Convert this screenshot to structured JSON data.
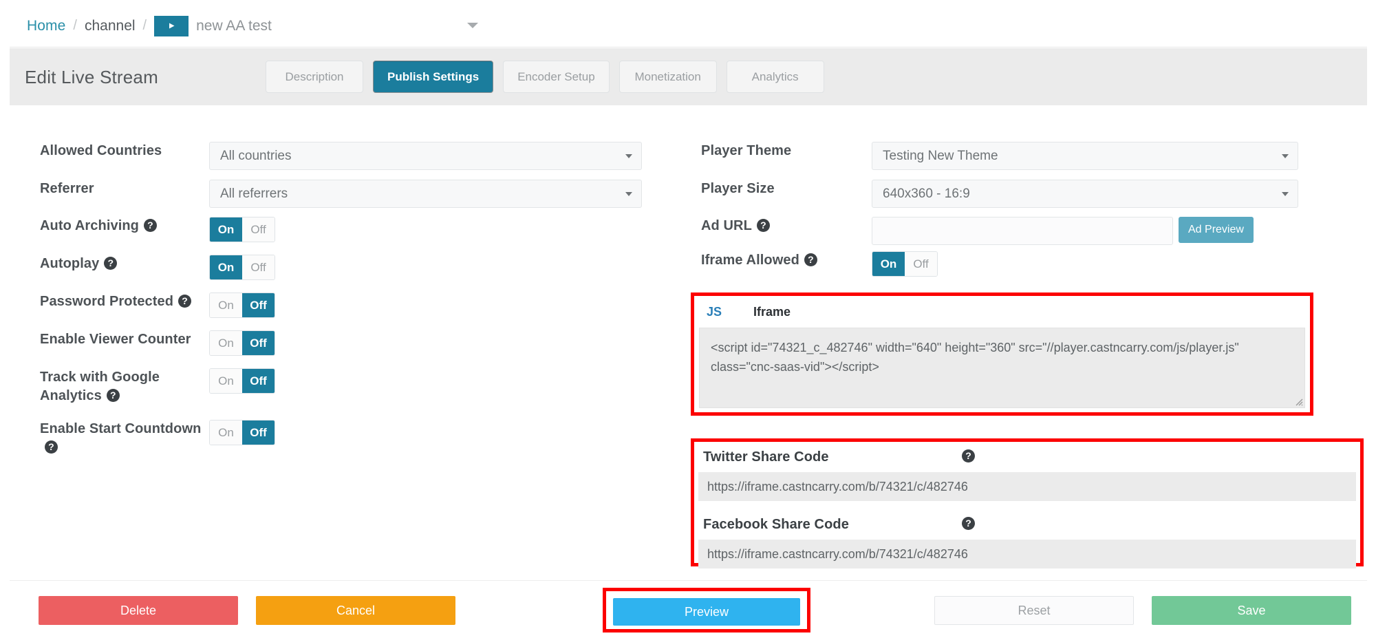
{
  "breadcrumb": {
    "home": "Home",
    "sep": "/",
    "channel": "channel",
    "stream_title": "new AA test",
    "play_icon": "play-icon",
    "caret_icon": "chevron-down-icon"
  },
  "header": {
    "page_title": "Edit Live Stream",
    "tabs": [
      {
        "label": "Description",
        "active": false
      },
      {
        "label": "Publish Settings",
        "active": true
      },
      {
        "label": "Encoder Setup",
        "active": false
      },
      {
        "label": "Monetization",
        "active": false
      },
      {
        "label": "Analytics",
        "active": false
      }
    ]
  },
  "left_column": {
    "allowed_countries": {
      "label": "Allowed Countries",
      "value": "All countries"
    },
    "referrer": {
      "label": "Referrer",
      "value": "All referrers"
    },
    "auto_archiving": {
      "label": "Auto Archiving",
      "help": "?",
      "on": "On",
      "off": "Off",
      "state": "On"
    },
    "autoplay": {
      "label": "Autoplay",
      "help": "?",
      "on": "On",
      "off": "Off",
      "state": "On"
    },
    "password_protected": {
      "label": "Password Protected",
      "help": "?",
      "on": "On",
      "off": "Off",
      "state": "Off"
    },
    "enable_viewer_counter": {
      "label": "Enable Viewer Counter",
      "on": "On",
      "off": "Off",
      "state": "Off"
    },
    "track_google_analytics": {
      "label": "Track with Google Analytics",
      "help": "?",
      "on": "On",
      "off": "Off",
      "state": "Off"
    },
    "enable_start_countdown": {
      "label": "Enable Start Countdown",
      "help": "?",
      "on": "On",
      "off": "Off",
      "state": "Off"
    }
  },
  "right_column": {
    "player_theme": {
      "label": "Player Theme",
      "value": "Testing New Theme"
    },
    "player_size": {
      "label": "Player Size",
      "value": "640x360 - 16:9"
    },
    "ad_url": {
      "label": "Ad URL",
      "help": "?",
      "value": "",
      "placeholder": "",
      "button": "Ad Preview"
    },
    "iframe_allowed": {
      "label": "Iframe Allowed",
      "help": "?",
      "on": "On",
      "off": "Off",
      "state": "On"
    }
  },
  "embed": {
    "tab_js": "JS",
    "tab_iframe": "Iframe",
    "code": "<script id=\"74321_c_482746\" width=\"640\" height=\"360\" src=\"//player.castncarry.com/js/player.js\" class=\"cnc-saas-vid\"></script>"
  },
  "share": {
    "twitter": {
      "label": "Twitter Share Code",
      "help": "?",
      "value": "https://iframe.castncarry.com/b/74321/c/482746"
    },
    "facebook": {
      "label": "Facebook Share Code",
      "help": "?",
      "value": "https://iframe.castncarry.com/b/74321/c/482746"
    }
  },
  "footer": {
    "delete": "Delete",
    "cancel": "Cancel",
    "preview": "Preview",
    "reset": "Reset",
    "save": "Save"
  },
  "colors": {
    "accent_teal": "#1b7d9d",
    "accent_link": "#2a8fa8",
    "ad_preview": "#5aa9c1",
    "highlight_red": "#fc0000",
    "delete_red": "#ec5f61",
    "cancel_orange": "#f5a011",
    "preview_blue": "#2fb3ef",
    "save_green": "#72c897",
    "page_grey": "#ebebeb"
  }
}
